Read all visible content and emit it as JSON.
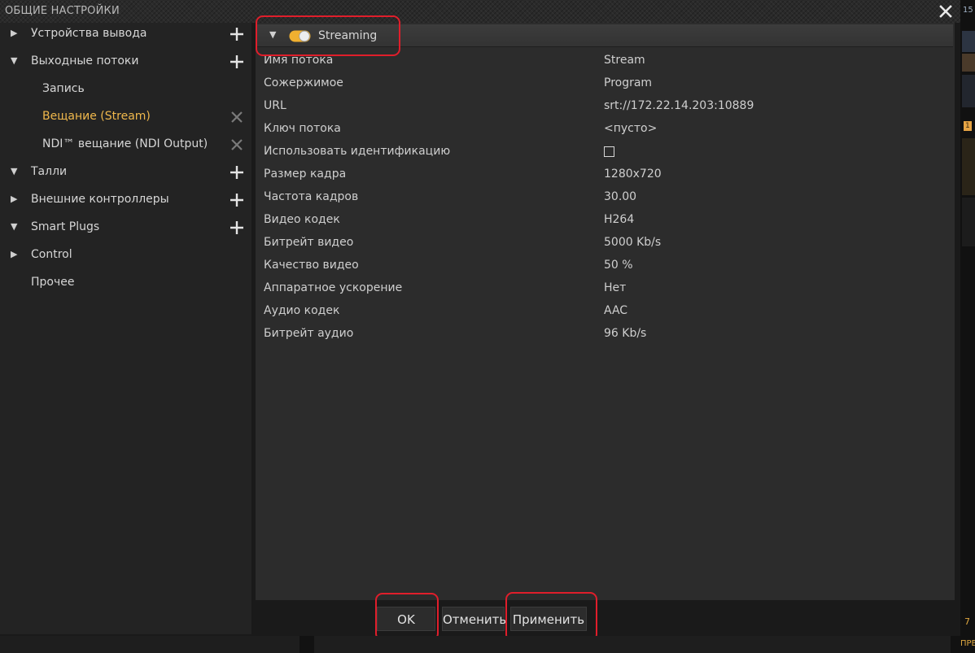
{
  "window": {
    "title": "ОБЩИЕ НАСТРОЙКИ",
    "close_icon": "close-icon"
  },
  "tree": {
    "items": [
      {
        "label": "Устройства вывода",
        "expanded": false,
        "level": 1,
        "action": "add"
      },
      {
        "label": "Выходные потоки",
        "expanded": true,
        "level": 1,
        "action": "add"
      },
      {
        "label": "Запись",
        "level": 2,
        "action": ""
      },
      {
        "label": "Вещание (Stream)",
        "level": 2,
        "action": "remove",
        "active": true
      },
      {
        "label": "NDI™ вещание (NDI Output)",
        "level": 2,
        "action": "remove"
      },
      {
        "label": "Талли",
        "expanded": true,
        "level": 1,
        "action": "add"
      },
      {
        "label": "Внешние контроллеры",
        "expanded": false,
        "level": 1,
        "action": "add"
      },
      {
        "label": "Smart Plugs",
        "expanded": true,
        "level": 1,
        "action": "add"
      },
      {
        "label": "Control",
        "expanded": false,
        "level": 1,
        "action": ""
      },
      {
        "label": "Прочее",
        "level": 1,
        "action": ""
      }
    ],
    "active_color": "#f0b84c"
  },
  "group": {
    "name": "Streaming",
    "enabled": true
  },
  "properties": [
    {
      "key": "Имя потока",
      "value": "Stream"
    },
    {
      "key": "Сожержимое",
      "value": "Program"
    },
    {
      "key": "URL",
      "value": "srt://172.22.14.203:10889"
    },
    {
      "key": "Ключ потока",
      "value": "<пусто>"
    },
    {
      "key": "Использовать идентификацию",
      "value": "",
      "checkbox": true,
      "checked": false
    },
    {
      "key": "Размер кадра",
      "value": "1280x720"
    },
    {
      "key": "Частота кадров",
      "value": "30.00"
    },
    {
      "key": "Видео кодек",
      "value": "H264"
    },
    {
      "key": "Битрейт видео",
      "value": "5000 Kb/s"
    },
    {
      "key": "Качество видео",
      "value": "50 %"
    },
    {
      "key": "Аппаратное ускорение",
      "value": "Нет"
    },
    {
      "key": "Аудио кодек",
      "value": "AAC"
    },
    {
      "key": "Битрейт аудио",
      "value": "96 Kb/s"
    }
  ],
  "buttons": {
    "ok": "OK",
    "cancel": "Отменить",
    "apply": "Применить"
  },
  "highlight_color": "#e01e2b",
  "side": {
    "top_text": "15",
    "badge": "1",
    "bottom_text1": "7",
    "bottom_text2": "ПРЕ"
  }
}
